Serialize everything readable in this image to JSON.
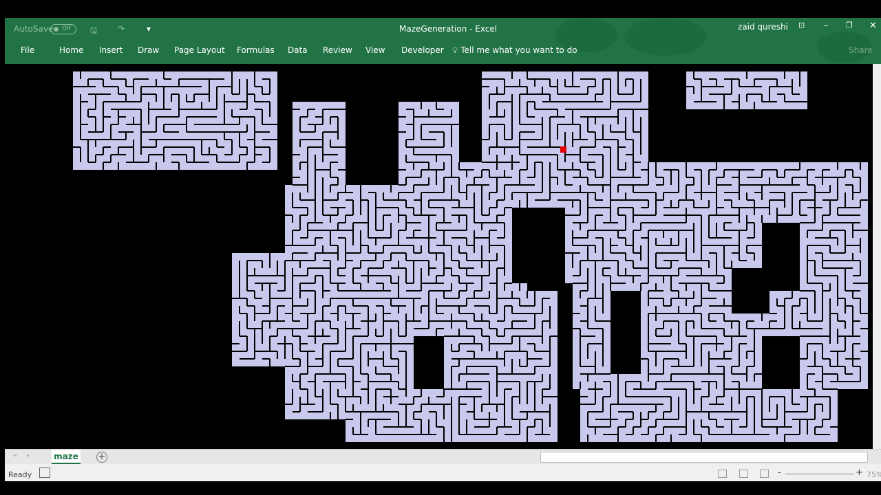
{
  "titlebar": {
    "autosave_label": "AutoSave",
    "autosave_state": "Off",
    "title": "MazeGeneration  -  Excel",
    "user": "zaid qureshi",
    "minimize": "–",
    "restore": "❐",
    "close": "✕",
    "ribbon_display": "⊡",
    "save": "🖫",
    "redo": "↷",
    "customize": "▾"
  },
  "ribbon": {
    "tabs": [
      "File",
      "Home",
      "Insert",
      "Draw",
      "Page Layout",
      "Formulas",
      "Data",
      "Review",
      "View",
      "Developer"
    ],
    "tell_me": "Tell me what you want to do",
    "share": "Share"
  },
  "sheets": {
    "active": "maze",
    "add": "+"
  },
  "status": {
    "ready": "Ready",
    "zoom": "75%",
    "zoom_minus": "-",
    "zoom_plus": "+"
  },
  "colors": {
    "path": "#c9c9ee",
    "wall": "#000000",
    "marker": "#e00000",
    "ribbon": "#217346"
  }
}
